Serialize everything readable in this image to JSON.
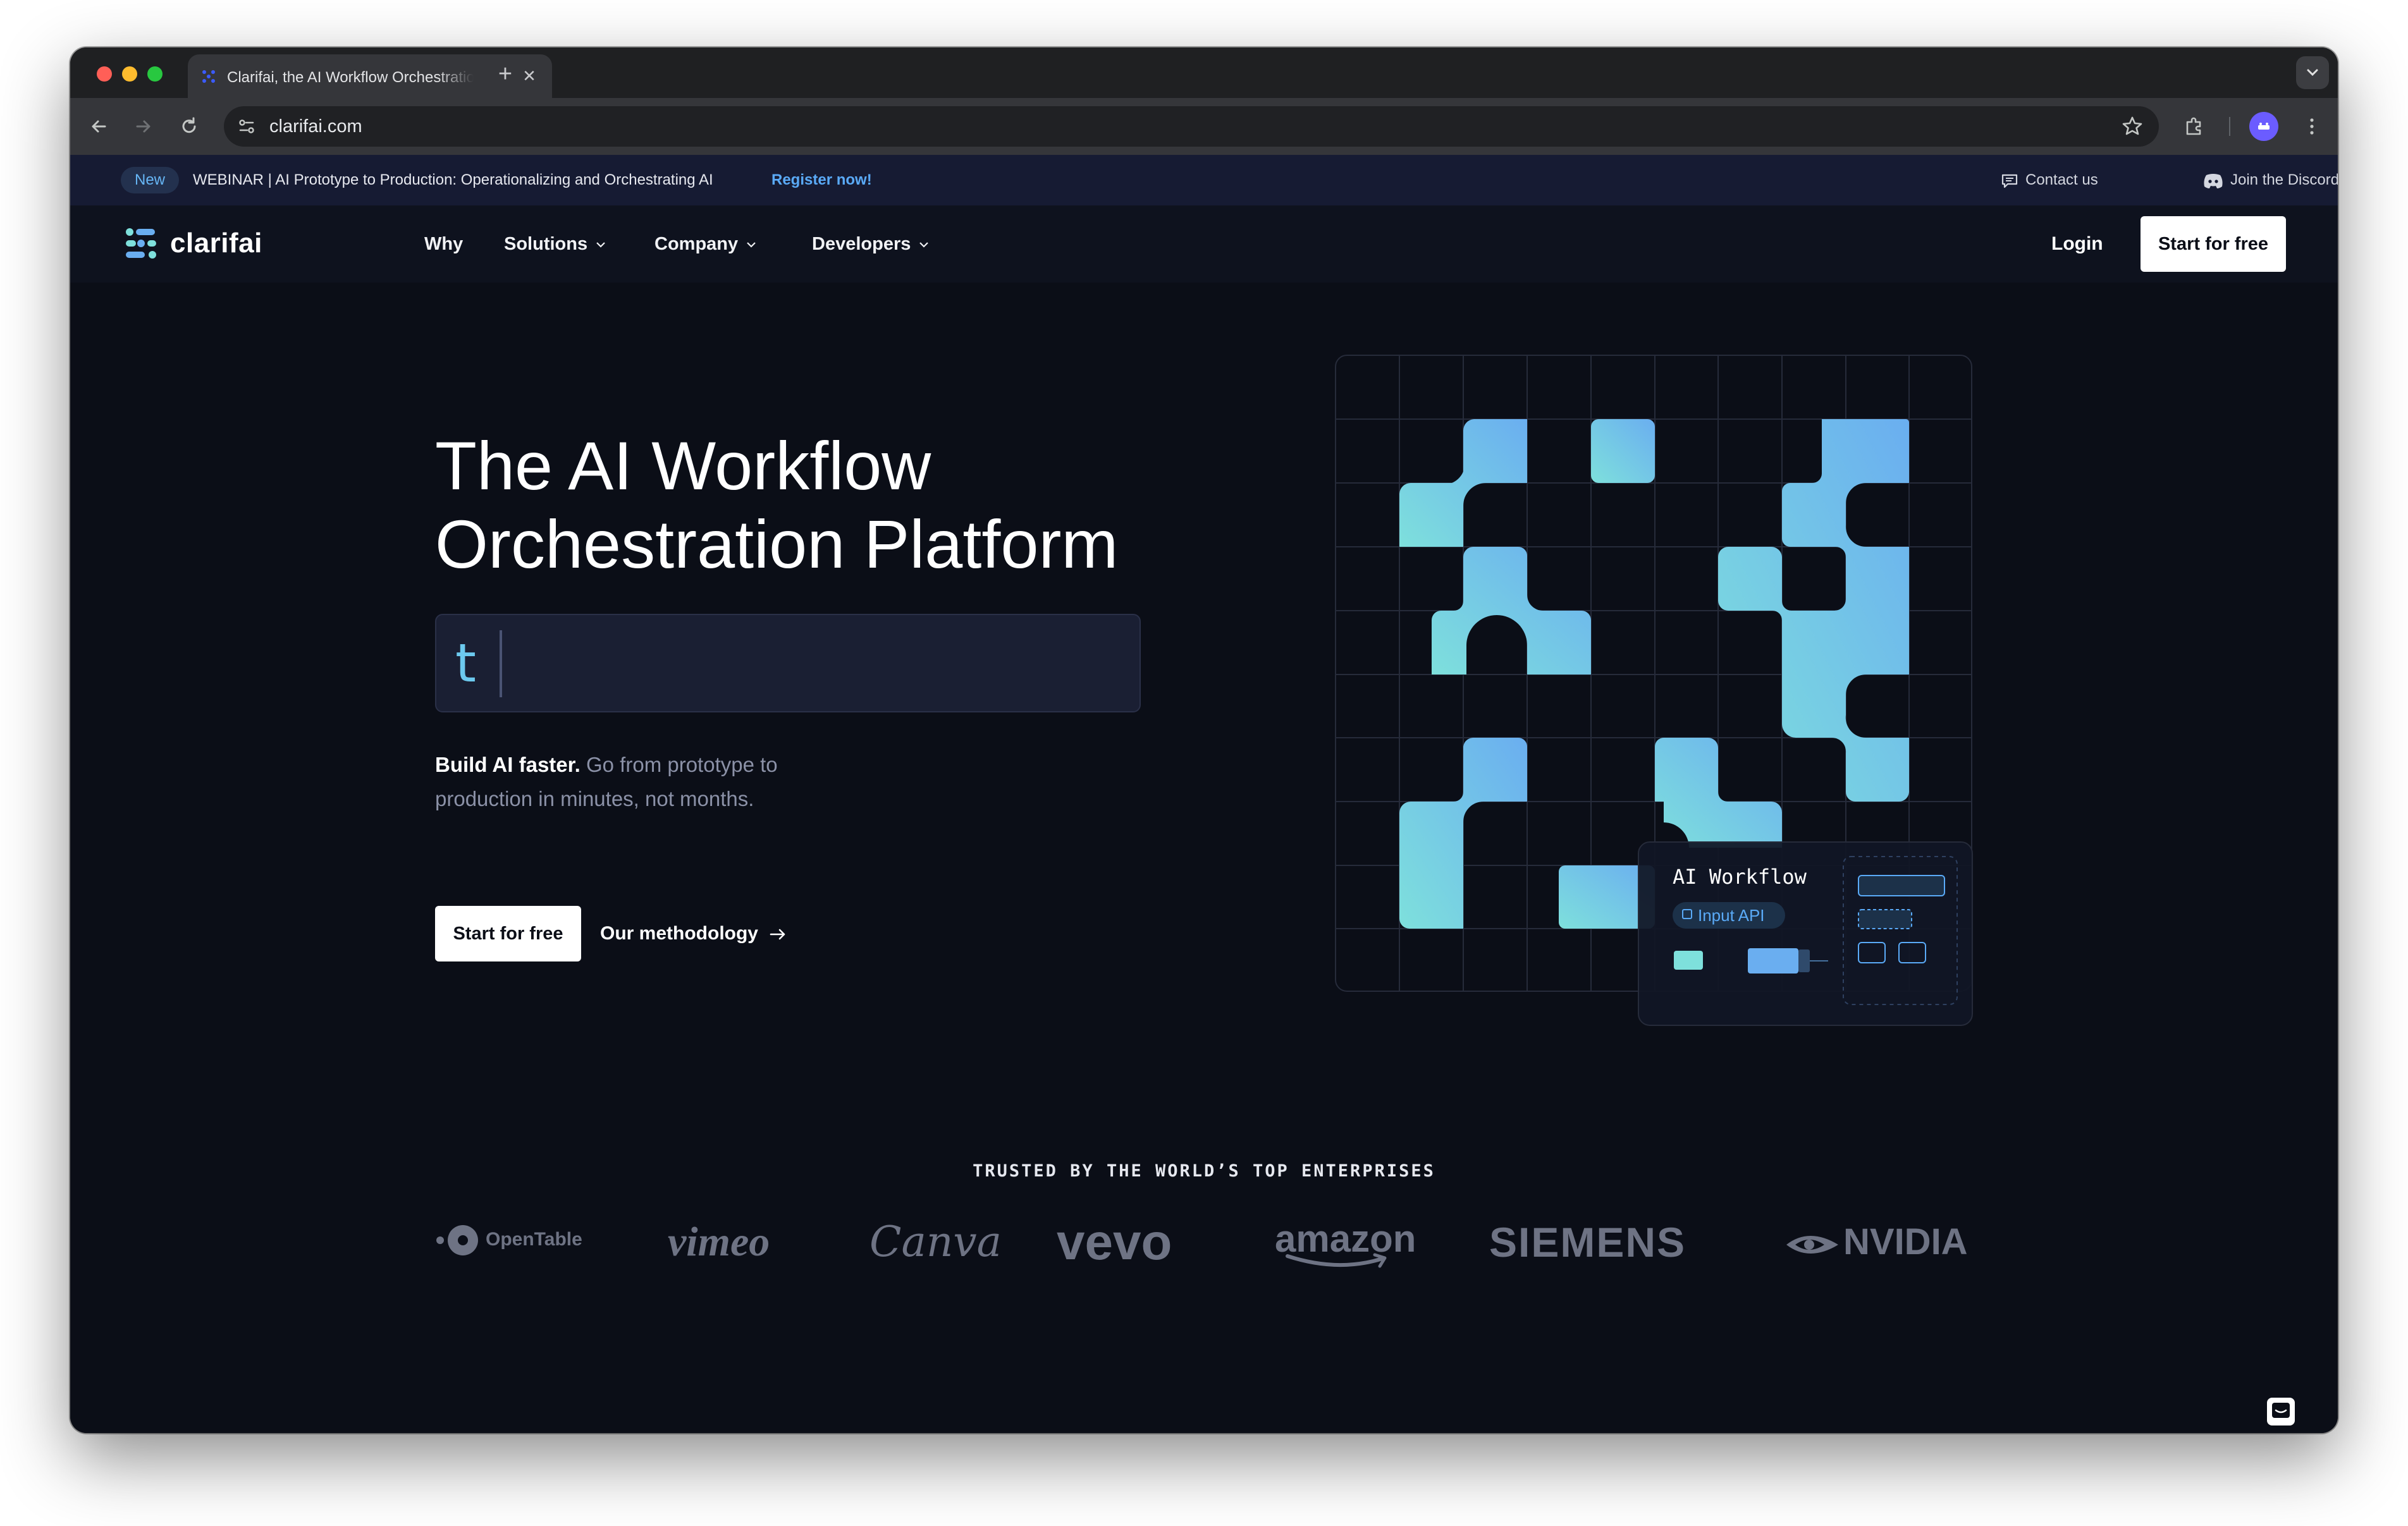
{
  "browser": {
    "tab_title": "Clarifai, the AI Workflow Orchestration Platform",
    "tab_close": "✕",
    "new_tab": "+",
    "url": "clarifai.com"
  },
  "banner": {
    "badge": "New",
    "text": "WEBINAR | AI Prototype to Production: Operationalizing and Orchestrating AI",
    "link": "Register now!",
    "contact": "Contact us",
    "discord": "Join the Discord"
  },
  "nav": {
    "brand": "clarifai",
    "items": [
      "Why",
      "Solutions",
      "Company",
      "Developers"
    ],
    "login": "Login",
    "start": "Start for free"
  },
  "hero": {
    "title_line1": "The AI Workflow",
    "title_line2": "Orchestration Platform",
    "prompt_text": "t",
    "sub_bold": "Build AI faster.",
    "sub_rest": " Go from prototype to production in minutes, not months.",
    "primary_cta": "Start for free",
    "secondary_cta": "Our methodology"
  },
  "workflow_card": {
    "title": "AI Workflow",
    "badge": "Input API"
  },
  "trusted": {
    "heading": "TRUSTED BY THE WORLD’S TOP ENTERPRISES",
    "logos": [
      "OpenTable",
      "vimeo",
      "Canva",
      "vevo",
      "amazon",
      "SIEMENS",
      "NVIDIA"
    ]
  },
  "icons": {
    "back": "arrow-left-icon",
    "forward": "arrow-right-icon",
    "reload": "reload-icon",
    "bookmark": "star-icon",
    "extensions": "puzzle-icon",
    "menu": "kebab-icon",
    "chat": "chat-icon"
  },
  "colors": {
    "page_bg": "#0b0e17",
    "banner_bg": "#161b33",
    "accent_link": "#5aaaf7",
    "tile_teal": "#7ee0dc",
    "tile_blue": "#6aaef0"
  }
}
